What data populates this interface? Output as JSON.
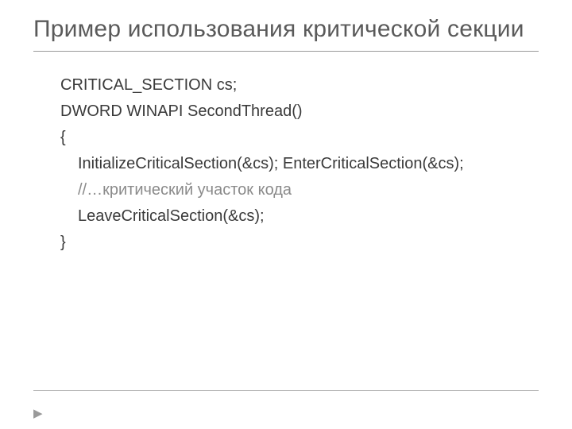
{
  "title": "Пример использования критической секции",
  "code": {
    "l1": "CRITICAL_SECTION cs;",
    "l2": "DWORD WINAPI SecondThread()",
    "l3": "{",
    "l4": "InitializeCriticalSection(&cs); EnterCriticalSection(&cs);",
    "l5": "//…критический участок кода",
    "l6": "LeaveCriticalSection(&cs);",
    "l7": "}"
  },
  "footer_arrow": "▶"
}
